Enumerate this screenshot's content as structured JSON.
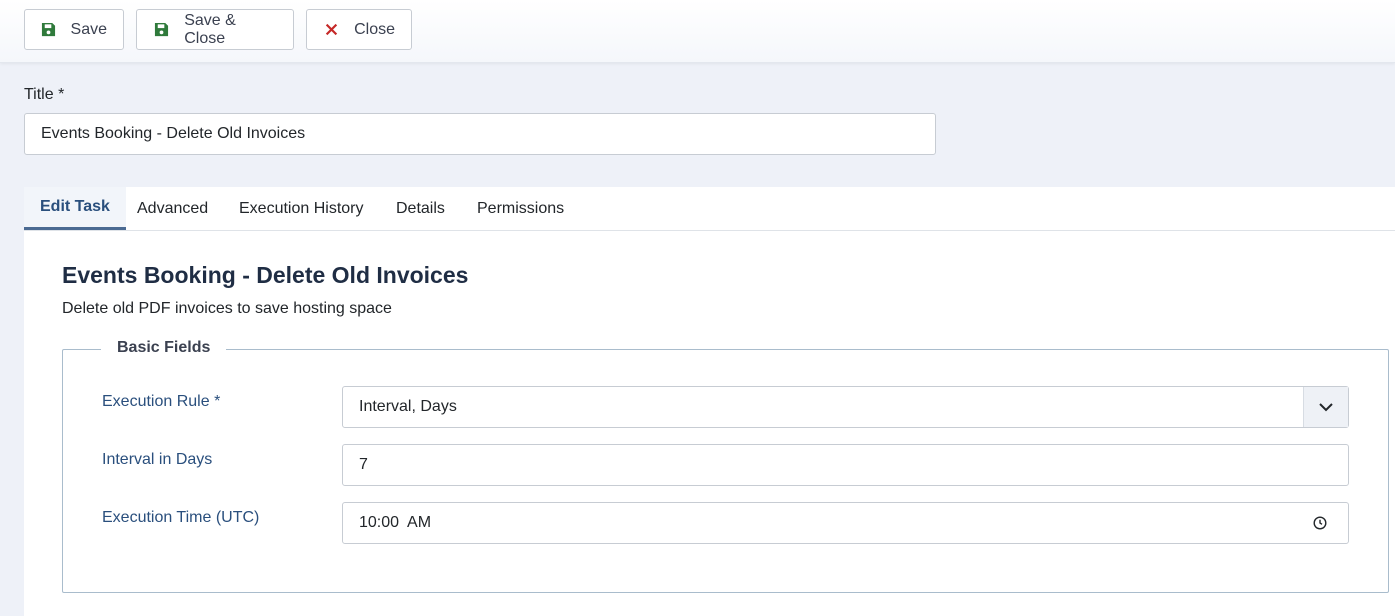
{
  "toolbar": {
    "save_label": "Save",
    "save_close_label": "Save & Close",
    "close_label": "Close",
    "save_icon_color": "#2f7a3b",
    "close_icon_color": "#c52827"
  },
  "title_field": {
    "label": "Title *",
    "value": "Events Booking - Delete Old Invoices"
  },
  "tabs": [
    {
      "label": "Edit Task",
      "active": true
    },
    {
      "label": "Advanced",
      "active": false
    },
    {
      "label": "Execution History",
      "active": false
    },
    {
      "label": "Details",
      "active": false
    },
    {
      "label": "Permissions",
      "active": false
    }
  ],
  "task": {
    "heading": "Events Booking - Delete Old Invoices",
    "description": "Delete old PDF invoices to save hosting space"
  },
  "basic_fields": {
    "legend": "Basic Fields",
    "execution_rule": {
      "label": "Execution Rule *",
      "value": "Interval, Days"
    },
    "interval_days": {
      "label": "Interval in Days",
      "value": "7"
    },
    "execution_time": {
      "label": "Execution Time (UTC)",
      "value": "10:00  AM"
    }
  }
}
